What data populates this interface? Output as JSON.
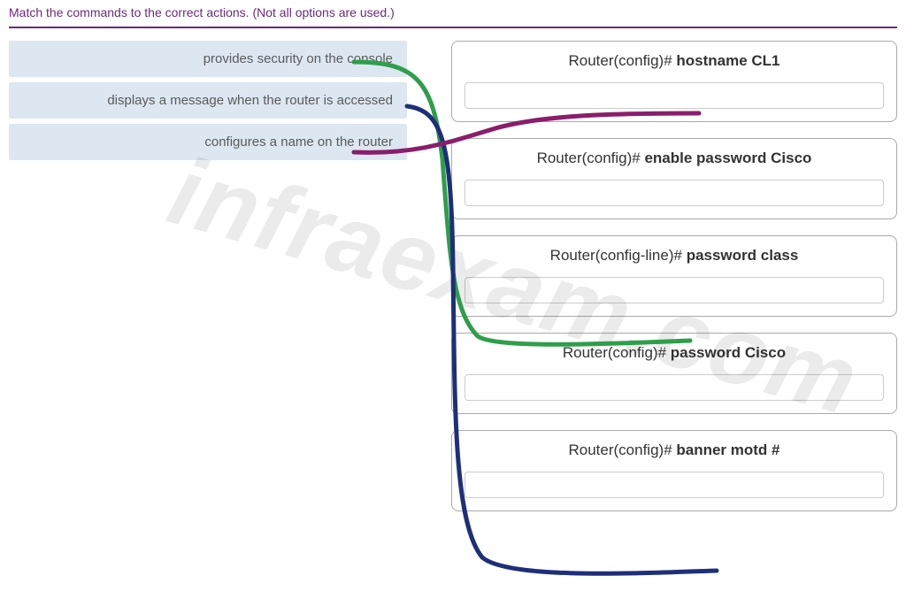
{
  "instruction": "Match the commands to the correct actions. (Not all options are used.)",
  "watermark": "infraexam.com",
  "actions": [
    {
      "label": "provides security on the console"
    },
    {
      "label": "displays a message when the router is accessed"
    },
    {
      "label": "configures a name on the router"
    }
  ],
  "targets": [
    {
      "prefix": "Router(config)# ",
      "cmd": "hostname CL1"
    },
    {
      "prefix": "Router(config)# ",
      "cmd": "enable password Cisco"
    },
    {
      "prefix": "Router(config-line)# ",
      "cmd": "password class"
    },
    {
      "prefix": "Router(config)# ",
      "cmd": "password Cisco"
    },
    {
      "prefix": "Router(config)# ",
      "cmd": "banner motd #"
    }
  ],
  "connections": [
    {
      "from_action": 0,
      "to_target": 2,
      "color": "#2e9e4a"
    },
    {
      "from_action": 1,
      "to_target": 4,
      "color": "#1e2f7a"
    },
    {
      "from_action": 2,
      "to_target": 0,
      "color": "#8a1e6b"
    }
  ]
}
